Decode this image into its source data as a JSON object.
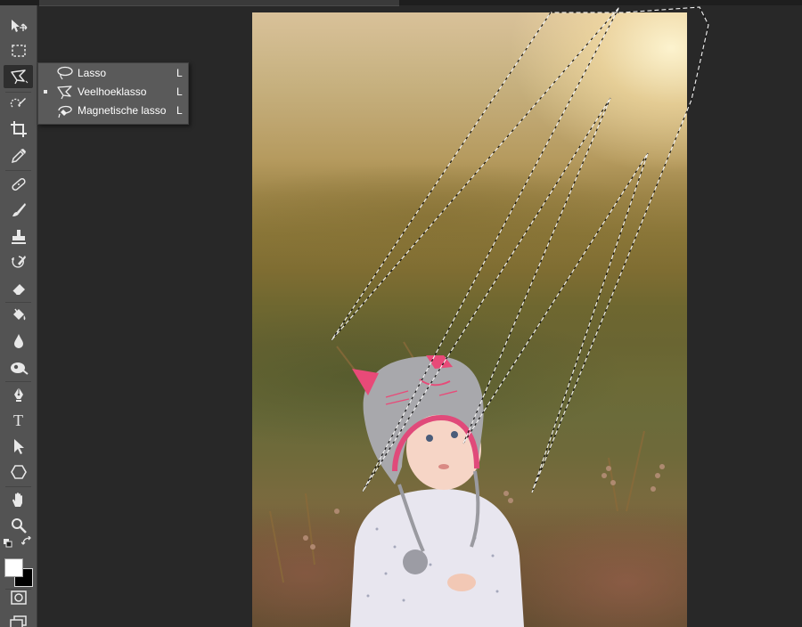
{
  "toolbar": {
    "tools": [
      {
        "name": "move-tool",
        "icon": "move-icon"
      },
      {
        "name": "marquee-tool",
        "icon": "marquee-icon"
      },
      {
        "name": "lasso-tool",
        "icon": "polygonal-lasso-icon",
        "active": true
      },
      {
        "name": "quick-selection-tool",
        "icon": "quick-selection-icon"
      },
      {
        "name": "crop-tool",
        "icon": "crop-icon"
      },
      {
        "name": "eyedropper-tool",
        "icon": "eyedropper-icon"
      },
      {
        "name": "healing-brush-tool",
        "icon": "bandage-icon"
      },
      {
        "name": "brush-tool",
        "icon": "brush-icon"
      },
      {
        "name": "clone-stamp-tool",
        "icon": "stamp-icon"
      },
      {
        "name": "history-brush-tool",
        "icon": "history-brush-icon"
      },
      {
        "name": "eraser-tool",
        "icon": "eraser-icon"
      },
      {
        "name": "paint-bucket-tool",
        "icon": "paint-bucket-icon"
      },
      {
        "name": "blur-tool",
        "icon": "drop-icon"
      },
      {
        "name": "dodge-tool",
        "icon": "dodge-icon"
      },
      {
        "name": "pen-tool",
        "icon": "pen-icon"
      },
      {
        "name": "type-tool",
        "icon": "type-icon",
        "glyph": "T"
      },
      {
        "name": "path-selection-tool",
        "icon": "arrow-icon"
      },
      {
        "name": "shape-tool",
        "icon": "hexagon-icon"
      },
      {
        "name": "hand-tool",
        "icon": "hand-icon"
      },
      {
        "name": "zoom-tool",
        "icon": "zoom-icon"
      }
    ],
    "colors": {
      "foreground": "#ffffff",
      "background": "#000000"
    }
  },
  "flyout": {
    "items": [
      {
        "label": "Lasso",
        "shortcut": "L",
        "icon": "lasso-icon",
        "selected": false
      },
      {
        "label": "Veelhoeklasso",
        "shortcut": "L",
        "icon": "polygonal-lasso-icon",
        "selected": true
      },
      {
        "label": "Magnetische lasso",
        "shortcut": "L",
        "icon": "magnetic-lasso-icon",
        "selected": false
      }
    ]
  },
  "colors": {
    "app_bg": "#282828",
    "toolbar_bg": "#535353",
    "flyout_bg": "#5a5a5a",
    "flyout_text": "#ffffff"
  }
}
